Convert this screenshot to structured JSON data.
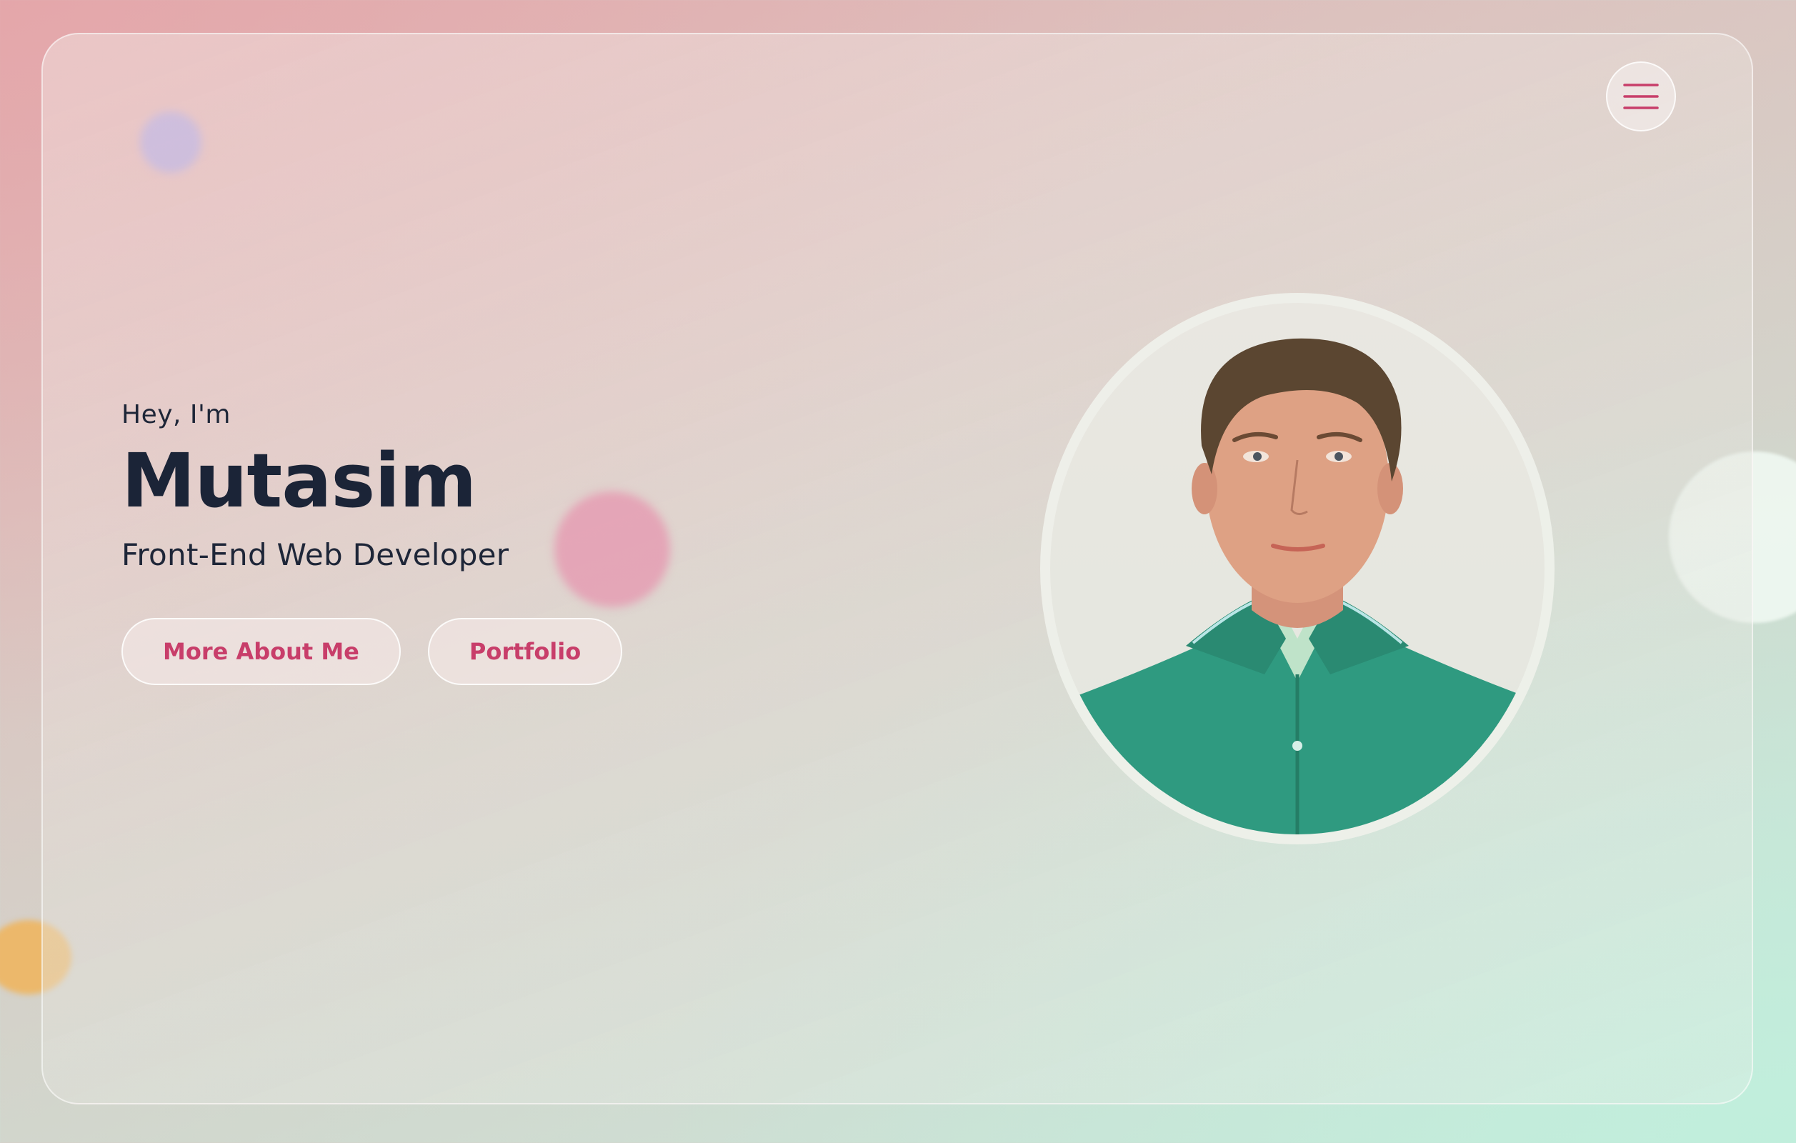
{
  "hero": {
    "greeting": "Hey, I'm",
    "name": "Mutasim",
    "role": "Front-End Web Developer",
    "buttons": {
      "about_label": "More About Me",
      "portfolio_label": "Portfolio"
    }
  },
  "nav": {
    "menu_icon": "hamburger-menu-icon"
  },
  "portrait": {
    "alt": "Mutasim"
  },
  "colors": {
    "accent": "#c83e6a",
    "heading": "#1b2437",
    "shirt": "#2f9a80"
  }
}
